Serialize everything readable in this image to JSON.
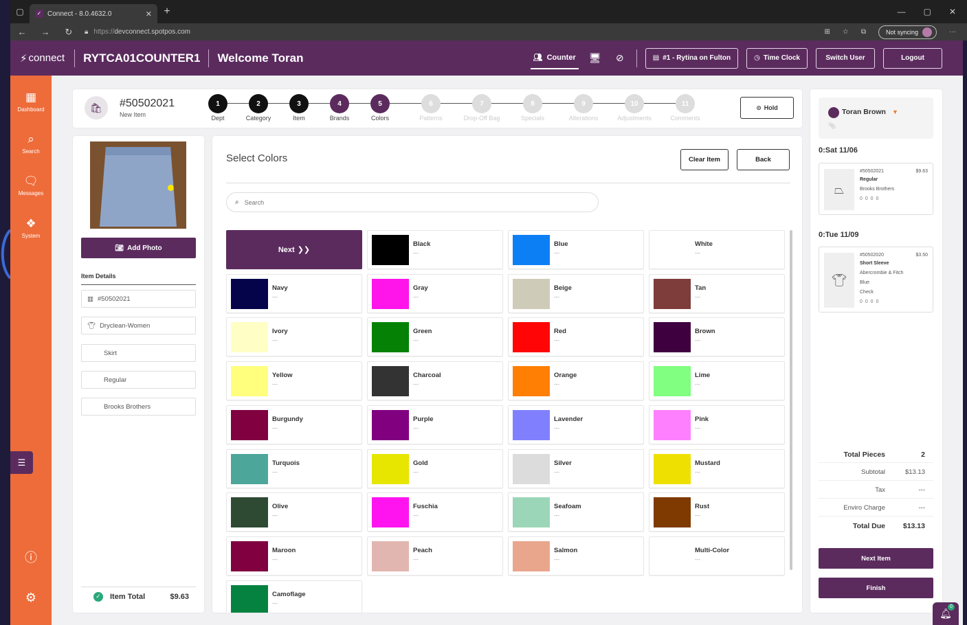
{
  "browser": {
    "tab_title": "Connect - 8.0.4632.0",
    "url_prefix": "https://",
    "url_host": "devconnect.spotpos.com",
    "sync_label": "Not syncing"
  },
  "header": {
    "brand": "connect",
    "store": "RYTCA01COUNTER1",
    "welcome": "Welcome Toran",
    "counter_label": "Counter",
    "location_label": "#1 - Rytina on Fulton",
    "timeclock_label": "Time Clock",
    "switchuser_label": "Switch User",
    "logout_label": "Logout"
  },
  "sidebar": {
    "items": [
      {
        "label": "Dashboard",
        "icon": "dashboard-icon"
      },
      {
        "label": "Search",
        "icon": "search-icon"
      },
      {
        "label": "Messages",
        "icon": "messages-icon"
      },
      {
        "label": "System",
        "icon": "system-icon"
      }
    ]
  },
  "order": {
    "number": "#50502021",
    "status": "New Item",
    "hold_label": "Hold"
  },
  "steps": [
    {
      "num": "1",
      "label": "Dept",
      "state": "done"
    },
    {
      "num": "2",
      "label": "Category",
      "state": "done"
    },
    {
      "num": "3",
      "label": "Item",
      "state": "done"
    },
    {
      "num": "4",
      "label": "Brands",
      "state": "active"
    },
    {
      "num": "5",
      "label": "Colors",
      "state": "active"
    },
    {
      "num": "6",
      "label": "Patterns",
      "state": "todo"
    },
    {
      "num": "7",
      "label": "Drop-Off Bag",
      "state": "todo"
    },
    {
      "num": "8",
      "label": "Specials",
      "state": "todo"
    },
    {
      "num": "9",
      "label": "Alterations",
      "state": "todo"
    },
    {
      "num": "10",
      "label": "Adjustments",
      "state": "todo"
    },
    {
      "num": "11",
      "label": "Comments",
      "state": "todo"
    }
  ],
  "item": {
    "add_photo_label": "Add Photo",
    "details_heading": "Item Details",
    "tag": "#50502021",
    "service": "Dryclean-Women",
    "type": "Skirt",
    "style": "Regular",
    "brand": "Brooks Brothers",
    "total_label": "Item Total",
    "total_value": "$9.63"
  },
  "colors": {
    "title": "Select Colors",
    "clear_label": "Clear Item",
    "back_label": "Back",
    "search_placeholder": "Search",
    "next_label": "Next",
    "dash": "---",
    "items": [
      {
        "name": "Black",
        "hex": "#000000"
      },
      {
        "name": "Blue",
        "hex": "#0d7ff5"
      },
      {
        "name": "White",
        "hex": "#ffffff"
      },
      {
        "name": "Navy",
        "hex": "#05044a"
      },
      {
        "name": "Gray",
        "hex": "#ff14ea"
      },
      {
        "name": "Beige",
        "hex": "#cfcbb9"
      },
      {
        "name": "Tan",
        "hex": "#7e3c3b"
      },
      {
        "name": "Ivory",
        "hex": "#fffec4"
      },
      {
        "name": "Green",
        "hex": "#058205"
      },
      {
        "name": "Red",
        "hex": "#ff0505"
      },
      {
        "name": "Brown",
        "hex": "#3f0040"
      },
      {
        "name": "Yellow",
        "hex": "#ffff7d"
      },
      {
        "name": "Charcoal",
        "hex": "#333333"
      },
      {
        "name": "Orange",
        "hex": "#ff7f05"
      },
      {
        "name": "Lime",
        "hex": "#80ff80"
      },
      {
        "name": "Burgundy",
        "hex": "#800040"
      },
      {
        "name": "Purple",
        "hex": "#800080"
      },
      {
        "name": "Lavender",
        "hex": "#8080ff"
      },
      {
        "name": "Pink",
        "hex": "#ff80ff"
      },
      {
        "name": "Turquois",
        "hex": "#4da69a"
      },
      {
        "name": "Gold",
        "hex": "#e6e600"
      },
      {
        "name": "Silver",
        "hex": "#dcdcdc"
      },
      {
        "name": "Mustard",
        "hex": "#eee000"
      },
      {
        "name": "Olive",
        "hex": "#2e4a33"
      },
      {
        "name": "Fuschia",
        "hex": "#ff14f0"
      },
      {
        "name": "Seafoam",
        "hex": "#9bd6b8"
      },
      {
        "name": "Rust",
        "hex": "#7e3a00"
      },
      {
        "name": "Maroon",
        "hex": "#800040"
      },
      {
        "name": "Peach",
        "hex": "#e2b6b0"
      },
      {
        "name": "Salmon",
        "hex": "#eaa68d"
      },
      {
        "name": "Multi-Color",
        "hex": "#ffffff"
      },
      {
        "name": "Camoflage",
        "hex": "#058240"
      }
    ]
  },
  "cart": {
    "customer": "Toran Brown",
    "groups": [
      {
        "date": "0:Sat 11/06",
        "tag": "#50502021",
        "price": "$9.63",
        "lines": [
          "Regular",
          "Brooks Brothers"
        ],
        "counts": "0  0  0  0"
      },
      {
        "date": "0:Tue 11/09",
        "tag": "#50502020",
        "price": "$3.50",
        "lines": [
          "Short Sleeve",
          "Abercrombie & Fitch",
          "Blue",
          "Check"
        ],
        "counts": "0  0  0  0"
      }
    ],
    "totals": {
      "pieces_label": "Total Pieces",
      "pieces_value": "2",
      "subtotal_label": "Subtotal",
      "subtotal_value": "$13.13",
      "tax_label": "Tax",
      "tax_value": "---",
      "enviro_label": "Enviro Charge",
      "enviro_value": "---",
      "due_label": "Total Due",
      "due_value": "$13.13"
    },
    "next_item_label": "Next Item",
    "finish_label": "Finish",
    "notif_count": "0"
  }
}
